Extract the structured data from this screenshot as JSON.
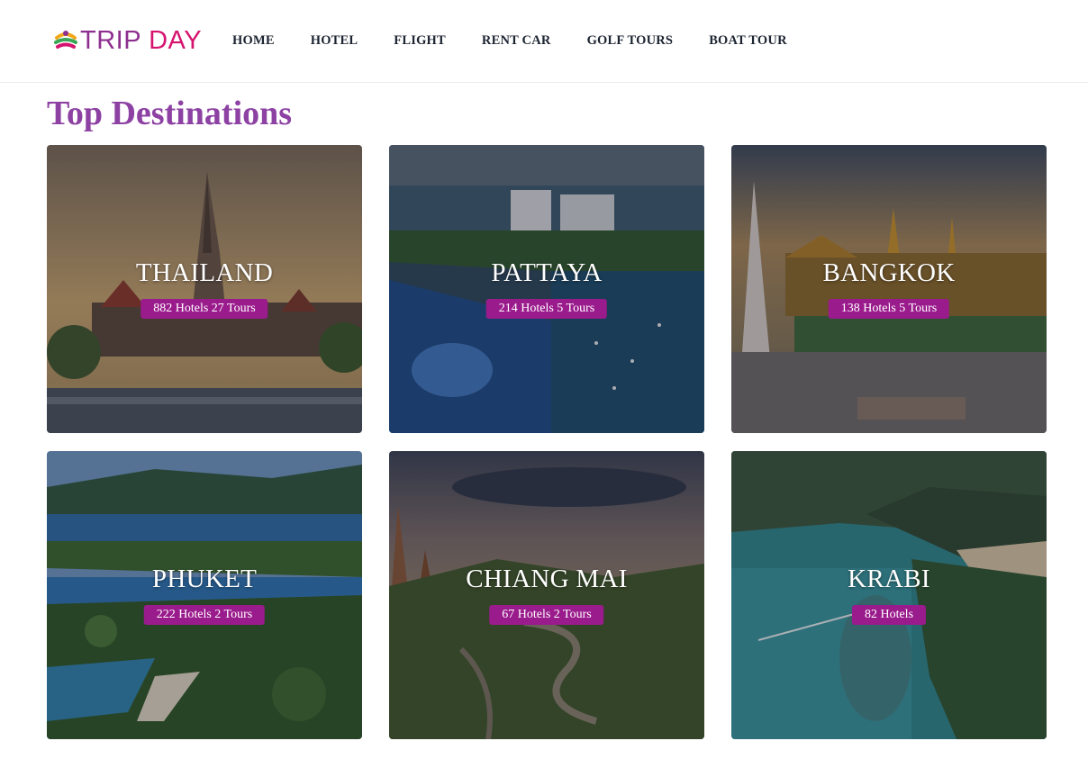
{
  "brand": {
    "name_part1": "TRIP",
    "name_part2": "DAY",
    "colors": {
      "trip": "#8e2f8f",
      "day": "#d6136e"
    }
  },
  "nav": {
    "items": [
      {
        "label": "HOME"
      },
      {
        "label": "HOTEL"
      },
      {
        "label": "FLIGHT"
      },
      {
        "label": "RENT CAR"
      },
      {
        "label": "GOLF TOURS"
      },
      {
        "label": "BOAT TOUR"
      }
    ]
  },
  "main": {
    "title": "Top Destinations",
    "title_color": "#8d42a3",
    "badge_color": "#9a1b8c",
    "destinations": [
      {
        "name": "THAILAND",
        "stats": "882 Hotels 27 Tours"
      },
      {
        "name": "PATTAYA",
        "stats": "214 Hotels 5 Tours"
      },
      {
        "name": "BANGKOK",
        "stats": "138 Hotels 5 Tours"
      },
      {
        "name": "PHUKET",
        "stats": "222 Hotels 2 Tours"
      },
      {
        "name": "CHIANG MAI",
        "stats": "67 Hotels 2 Tours"
      },
      {
        "name": "KRABI",
        "stats": "82 Hotels"
      }
    ]
  }
}
